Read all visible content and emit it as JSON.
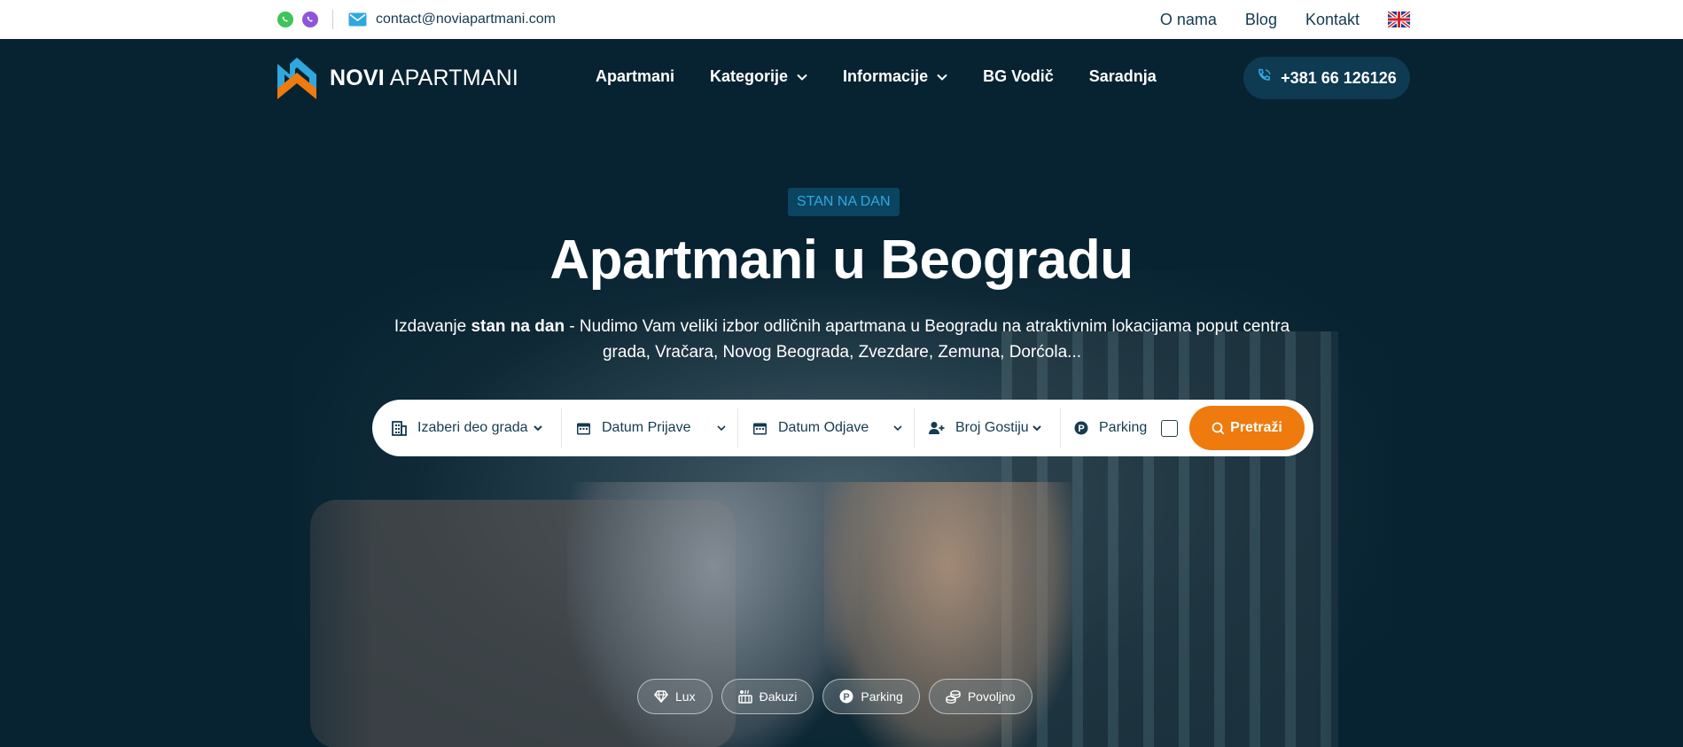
{
  "topbar": {
    "email": "contact@noviapartmani.com",
    "links": [
      "O nama",
      "Blog",
      "Kontakt"
    ],
    "icons": [
      "whatsapp-icon",
      "viber-icon",
      "mail-icon",
      "uk-flag-icon"
    ]
  },
  "header": {
    "logo_bold": "NOVI",
    "logo_rest": " APARTMANI",
    "menu": [
      "Apartmani",
      "Kategorije",
      "Informacije",
      "BG Vodič",
      "Saradnja"
    ],
    "phone": "+381 66 126126"
  },
  "hero": {
    "badge": "STAN NA DAN",
    "title": "Apartmani u Beogradu",
    "subtitle_part1": "Izdavanje ",
    "subtitle_bold": "stan na dan",
    "subtitle_part2": " - Nudimo Vam veliki izbor odličnih apartmana u Beogradu na atraktivnim lokacijama poput centra grada, Vračara, Novog Beograda, Zvezdare, Zemuna, Dorćola..."
  },
  "search": {
    "district": "Izaberi deo grada",
    "checkin": "Datum Prijave",
    "checkout": "Datum Odjave",
    "guests": "Broj Gostiju",
    "parking": "Parking",
    "button": "Pretraži"
  },
  "chips": [
    "Lux",
    "Đakuzi",
    "Parking",
    "Povoljno"
  ],
  "colors": {
    "navy": "#072331",
    "accent_orange": "#ef7a0e",
    "badge_blue": "#2fa8e0"
  }
}
